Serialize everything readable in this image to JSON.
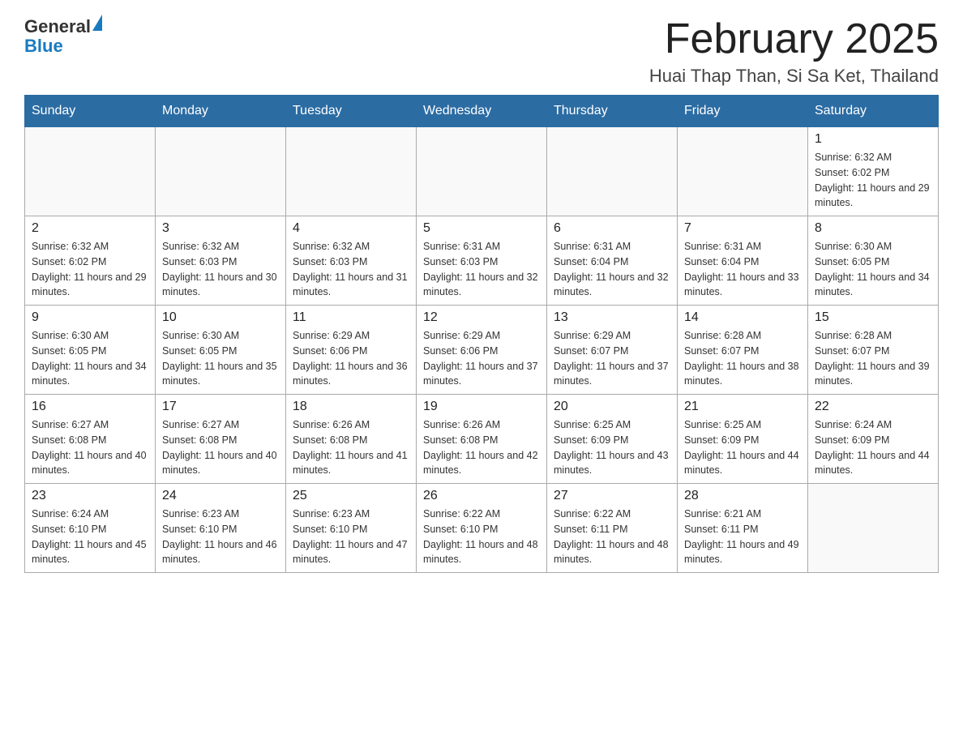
{
  "header": {
    "logo_general": "General",
    "logo_blue": "Blue",
    "month_title": "February 2025",
    "location": "Huai Thap Than, Si Sa Ket, Thailand"
  },
  "weekdays": [
    "Sunday",
    "Monday",
    "Tuesday",
    "Wednesday",
    "Thursday",
    "Friday",
    "Saturday"
  ],
  "weeks": [
    [
      {
        "day": "",
        "info": ""
      },
      {
        "day": "",
        "info": ""
      },
      {
        "day": "",
        "info": ""
      },
      {
        "day": "",
        "info": ""
      },
      {
        "day": "",
        "info": ""
      },
      {
        "day": "",
        "info": ""
      },
      {
        "day": "1",
        "info": "Sunrise: 6:32 AM\nSunset: 6:02 PM\nDaylight: 11 hours and 29 minutes."
      }
    ],
    [
      {
        "day": "2",
        "info": "Sunrise: 6:32 AM\nSunset: 6:02 PM\nDaylight: 11 hours and 29 minutes."
      },
      {
        "day": "3",
        "info": "Sunrise: 6:32 AM\nSunset: 6:03 PM\nDaylight: 11 hours and 30 minutes."
      },
      {
        "day": "4",
        "info": "Sunrise: 6:32 AM\nSunset: 6:03 PM\nDaylight: 11 hours and 31 minutes."
      },
      {
        "day": "5",
        "info": "Sunrise: 6:31 AM\nSunset: 6:03 PM\nDaylight: 11 hours and 32 minutes."
      },
      {
        "day": "6",
        "info": "Sunrise: 6:31 AM\nSunset: 6:04 PM\nDaylight: 11 hours and 32 minutes."
      },
      {
        "day": "7",
        "info": "Sunrise: 6:31 AM\nSunset: 6:04 PM\nDaylight: 11 hours and 33 minutes."
      },
      {
        "day": "8",
        "info": "Sunrise: 6:30 AM\nSunset: 6:05 PM\nDaylight: 11 hours and 34 minutes."
      }
    ],
    [
      {
        "day": "9",
        "info": "Sunrise: 6:30 AM\nSunset: 6:05 PM\nDaylight: 11 hours and 34 minutes."
      },
      {
        "day": "10",
        "info": "Sunrise: 6:30 AM\nSunset: 6:05 PM\nDaylight: 11 hours and 35 minutes."
      },
      {
        "day": "11",
        "info": "Sunrise: 6:29 AM\nSunset: 6:06 PM\nDaylight: 11 hours and 36 minutes."
      },
      {
        "day": "12",
        "info": "Sunrise: 6:29 AM\nSunset: 6:06 PM\nDaylight: 11 hours and 37 minutes."
      },
      {
        "day": "13",
        "info": "Sunrise: 6:29 AM\nSunset: 6:07 PM\nDaylight: 11 hours and 37 minutes."
      },
      {
        "day": "14",
        "info": "Sunrise: 6:28 AM\nSunset: 6:07 PM\nDaylight: 11 hours and 38 minutes."
      },
      {
        "day": "15",
        "info": "Sunrise: 6:28 AM\nSunset: 6:07 PM\nDaylight: 11 hours and 39 minutes."
      }
    ],
    [
      {
        "day": "16",
        "info": "Sunrise: 6:27 AM\nSunset: 6:08 PM\nDaylight: 11 hours and 40 minutes."
      },
      {
        "day": "17",
        "info": "Sunrise: 6:27 AM\nSunset: 6:08 PM\nDaylight: 11 hours and 40 minutes."
      },
      {
        "day": "18",
        "info": "Sunrise: 6:26 AM\nSunset: 6:08 PM\nDaylight: 11 hours and 41 minutes."
      },
      {
        "day": "19",
        "info": "Sunrise: 6:26 AM\nSunset: 6:08 PM\nDaylight: 11 hours and 42 minutes."
      },
      {
        "day": "20",
        "info": "Sunrise: 6:25 AM\nSunset: 6:09 PM\nDaylight: 11 hours and 43 minutes."
      },
      {
        "day": "21",
        "info": "Sunrise: 6:25 AM\nSunset: 6:09 PM\nDaylight: 11 hours and 44 minutes."
      },
      {
        "day": "22",
        "info": "Sunrise: 6:24 AM\nSunset: 6:09 PM\nDaylight: 11 hours and 44 minutes."
      }
    ],
    [
      {
        "day": "23",
        "info": "Sunrise: 6:24 AM\nSunset: 6:10 PM\nDaylight: 11 hours and 45 minutes."
      },
      {
        "day": "24",
        "info": "Sunrise: 6:23 AM\nSunset: 6:10 PM\nDaylight: 11 hours and 46 minutes."
      },
      {
        "day": "25",
        "info": "Sunrise: 6:23 AM\nSunset: 6:10 PM\nDaylight: 11 hours and 47 minutes."
      },
      {
        "day": "26",
        "info": "Sunrise: 6:22 AM\nSunset: 6:10 PM\nDaylight: 11 hours and 48 minutes."
      },
      {
        "day": "27",
        "info": "Sunrise: 6:22 AM\nSunset: 6:11 PM\nDaylight: 11 hours and 48 minutes."
      },
      {
        "day": "28",
        "info": "Sunrise: 6:21 AM\nSunset: 6:11 PM\nDaylight: 11 hours and 49 minutes."
      },
      {
        "day": "",
        "info": ""
      }
    ]
  ]
}
